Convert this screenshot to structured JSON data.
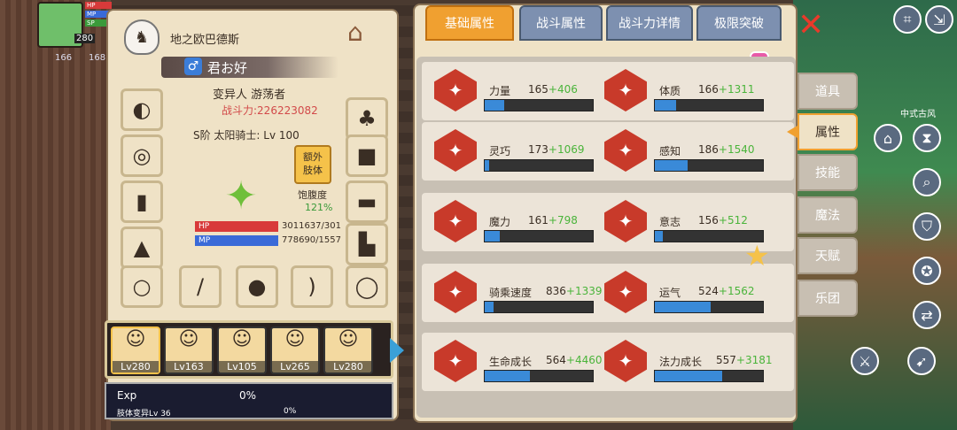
{
  "hud": {
    "level": "280",
    "stat_a": "166",
    "stat_b": "168",
    "hp_label": "HP",
    "mp_label": "MP",
    "sp_label": "SP",
    "hp_value": "3011637"
  },
  "profile": {
    "guild_name": "地之欧巴德斯",
    "char_name": "君お好",
    "race_class": "变异人 游荡者",
    "power": "战斗力:226223082",
    "class_level": "S阶 太阳骑士: Lv 100",
    "extra_limb_line1": "额外",
    "extra_limb_line2": "肢体",
    "satiety_label": "饱腹度",
    "satiety_value": "121%",
    "hp_label": "HP",
    "mp_label": "MP",
    "hp_value": "3011637/301",
    "mp_value": "778690/1557"
  },
  "party": [
    {
      "level": "Lv280"
    },
    {
      "level": "Lv163"
    },
    {
      "level": "Lv105"
    },
    {
      "level": "Lv265"
    },
    {
      "level": "Lv280"
    }
  ],
  "exp": {
    "label": "Exp",
    "percent": "0%",
    "mutation_label": "肢体变异Lv 36",
    "mutation_percent": "0%"
  },
  "tabs": [
    "基础属性",
    "战斗属性",
    "战斗力详情",
    "极限突破"
  ],
  "stats": [
    {
      "name": "力量",
      "base": "165",
      "bonus": "+406",
      "fill": 0.18
    },
    {
      "name": "体质",
      "base": "166",
      "bonus": "+1311",
      "fill": 0.2
    },
    {
      "name": "灵巧",
      "base": "173",
      "bonus": "+1069",
      "fill": 0.04
    },
    {
      "name": "感知",
      "base": "186",
      "bonus": "+1540",
      "fill": 0.3
    },
    {
      "name": "魔力",
      "base": "161",
      "bonus": "+798",
      "fill": 0.14
    },
    {
      "name": "意志",
      "base": "156",
      "bonus": "+512",
      "fill": 0.07
    },
    {
      "name": "骑乘速度",
      "base": "836",
      "bonus": "+1339",
      "fill": 0.08
    },
    {
      "name": "运气",
      "base": "524",
      "bonus": "+1562",
      "fill": 0.52
    },
    {
      "name": "生命成长",
      "base": "564",
      "bonus": "+4460",
      "fill": 0.42
    },
    {
      "name": "法力成长",
      "base": "557",
      "bonus": "+3181",
      "fill": 0.62
    }
  ],
  "side_tabs": [
    "道具",
    "属性",
    "技能",
    "魔法",
    "天赋",
    "乐团"
  ],
  "location": "中式古风",
  "colors": {
    "tab_active": "#f0a030",
    "tab_inactive": "#7d90b0",
    "bonus": "#4ab43a",
    "power": "#d24a4a",
    "stat_fill": "#3a8ad8"
  }
}
